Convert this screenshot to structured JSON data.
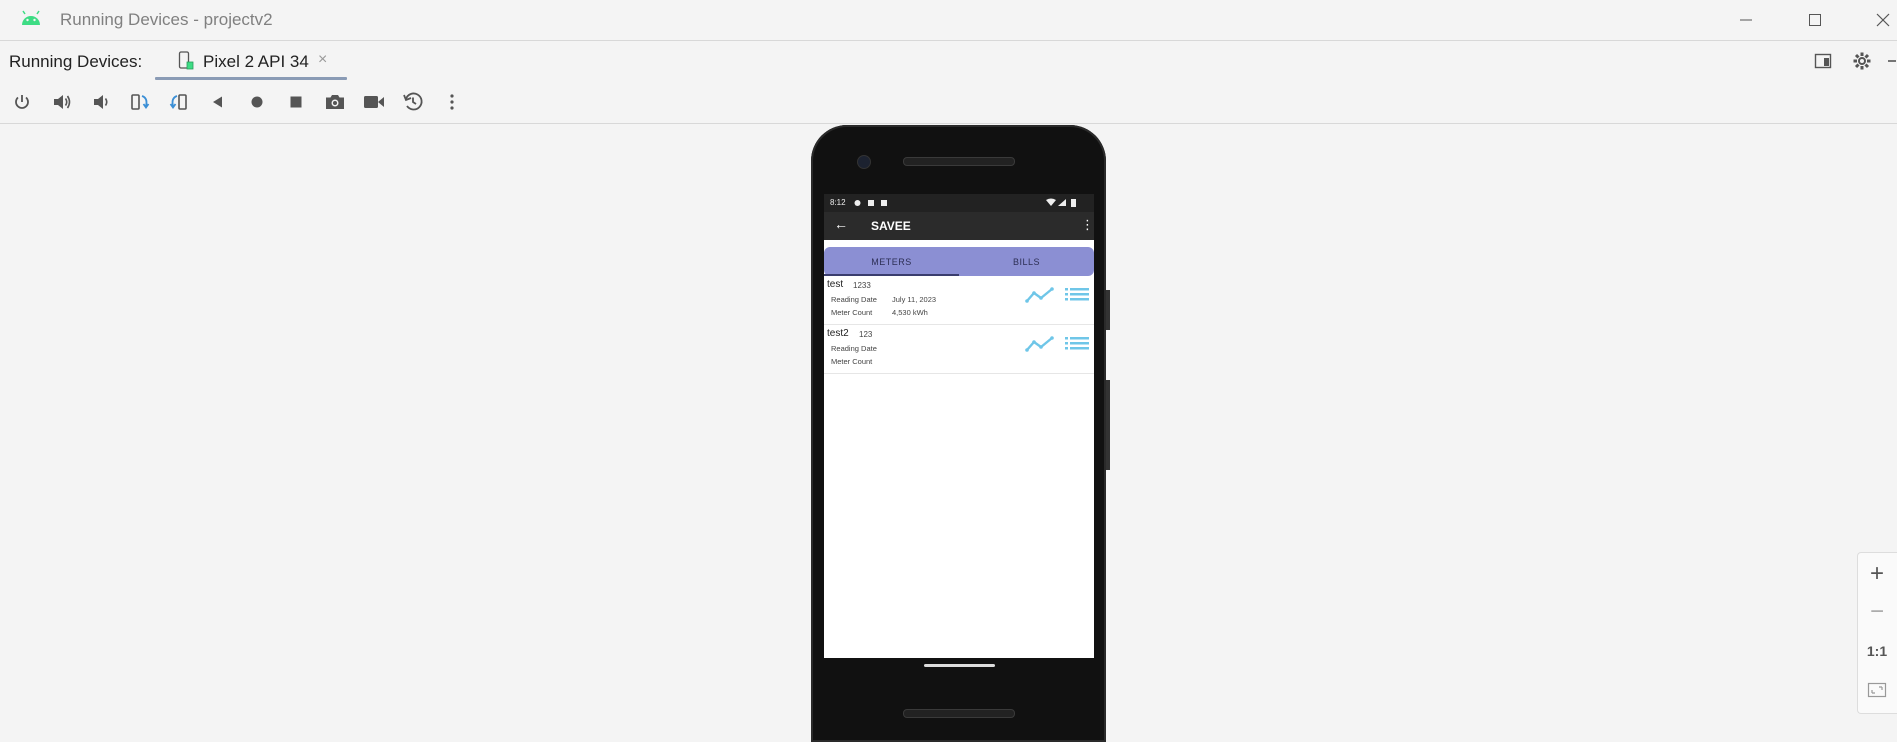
{
  "window": {
    "title": "Running Devices - projectv2",
    "minimize_icon": "minimize-icon",
    "maximize_icon": "maximize-icon",
    "close_icon": "close-icon"
  },
  "header": {
    "running_label": "Running Devices:",
    "device_tab": {
      "label": "Pixel 2 API 34",
      "icon": "device-icon",
      "close": "×"
    },
    "right_icons": [
      "layout-icon",
      "gear-icon",
      "hide-icon"
    ]
  },
  "toolbar": {
    "items": [
      "power-icon",
      "volume-up-icon",
      "volume-down-icon",
      "rotate-left-icon",
      "rotate-right-icon",
      "back-icon",
      "home-icon",
      "overview-icon",
      "screenshot-icon",
      "screen-record-icon",
      "snapshot-icon",
      "more-icon"
    ]
  },
  "device": {
    "status_time": "8:12",
    "app_title": "SAVEE",
    "back_arrow": "←",
    "overflow": "⋮",
    "tabs": [
      "METERS",
      "BILLS"
    ],
    "active_tab": "METERS",
    "rows": [
      {
        "name": "test",
        "number": "1233",
        "reading_date_label": "Reading Date",
        "reading_date": "July 11, 2023",
        "meter_count_label": "Meter Count",
        "meter_count": "4,530 kWh"
      },
      {
        "name": "test2",
        "number": "123",
        "reading_date_label": "Reading Date",
        "reading_date": "",
        "meter_count_label": "Meter Count",
        "meter_count": ""
      }
    ],
    "accent_color": "#8b8fd3",
    "icon_color": "#6fc6e8"
  },
  "zoom": {
    "zoom_in": "+",
    "zoom_out": "−",
    "actual_size": "1:1",
    "fit": "fit-screen-icon"
  }
}
